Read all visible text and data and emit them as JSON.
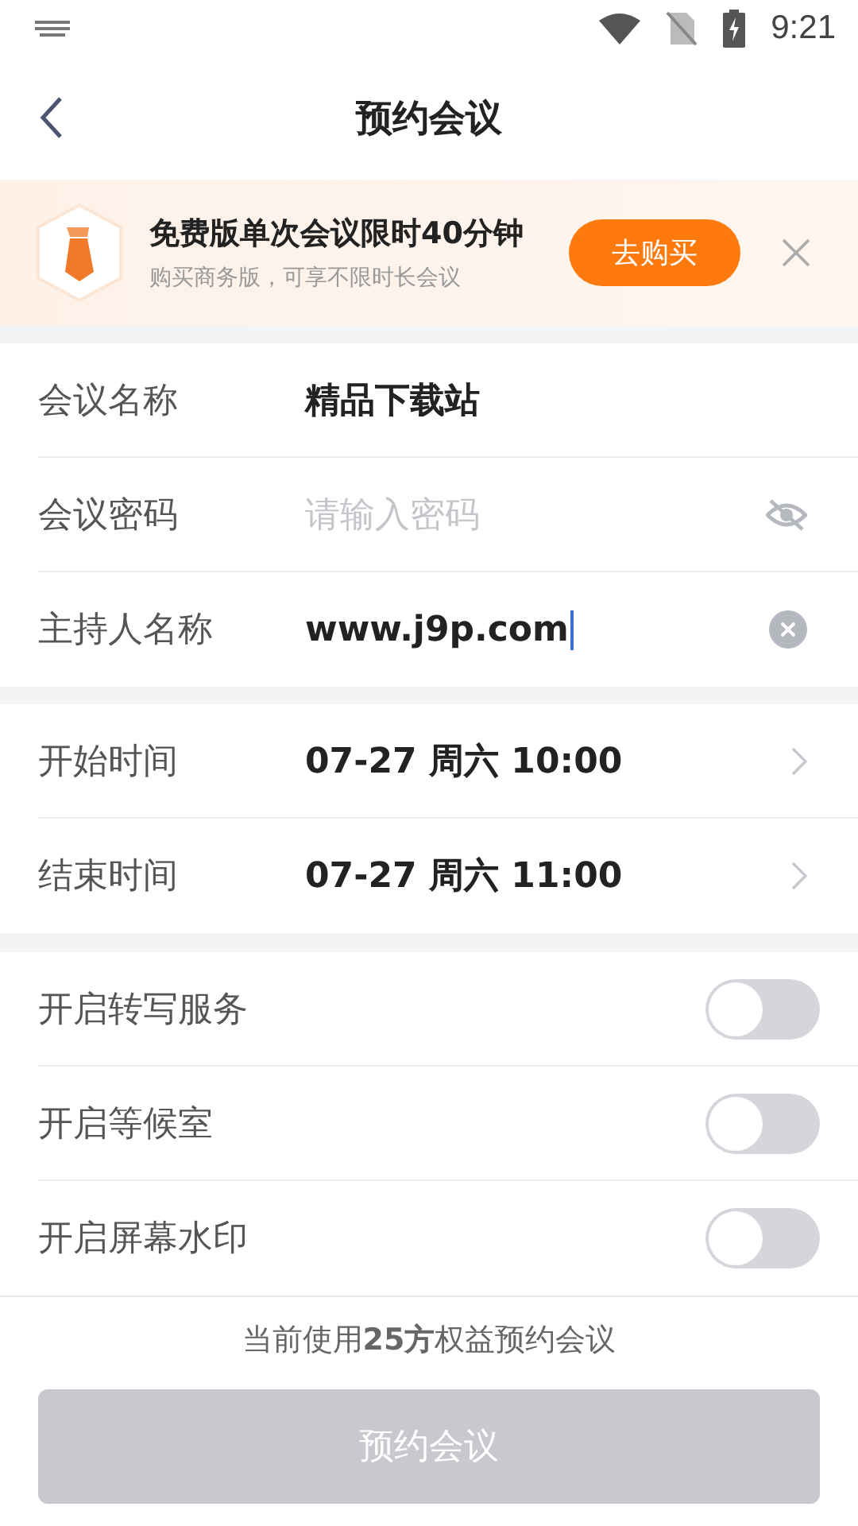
{
  "status_bar": {
    "time": "9:21"
  },
  "header": {
    "title": "预约会议"
  },
  "promo": {
    "title": "免费版单次会议限时40分钟",
    "subtitle": "购买商务版，可享不限时长会议",
    "button": "去购买"
  },
  "fields": [
    {
      "kind": "text",
      "label": "会议名称",
      "value": "精品下载站",
      "focused": false
    },
    {
      "kind": "password",
      "label": "会议密码",
      "placeholder": "请输入密码",
      "focused": false
    },
    {
      "kind": "clearable",
      "label": "主持人名称",
      "value": "www.j9p.com",
      "focused": true
    }
  ],
  "times": [
    {
      "label": "开始时间",
      "value": "07-27 周六 10:00"
    },
    {
      "label": "结束时间",
      "value": "07-27 周六 11:00"
    }
  ],
  "toggles": [
    {
      "label": "开启转写服务",
      "on": false
    },
    {
      "label": "开启等候室",
      "on": false
    },
    {
      "label": "开启屏幕水印",
      "on": false
    }
  ],
  "note": "当前使用**25方**权益预约会议",
  "submit": {
    "label": "预约会议",
    "disabled": true
  }
}
